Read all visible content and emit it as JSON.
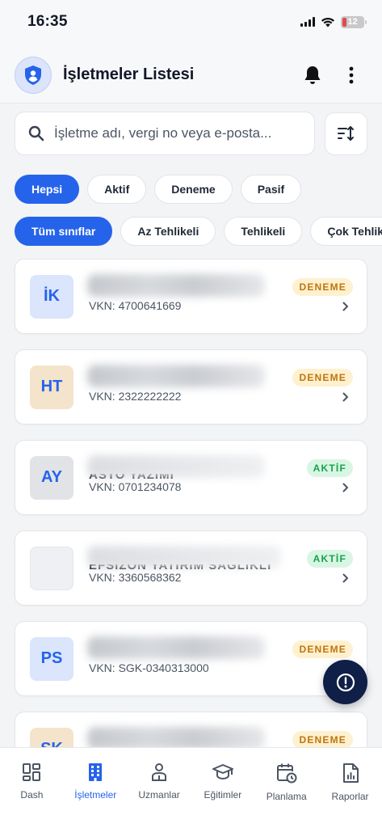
{
  "status_bar": {
    "time": "16:35",
    "battery": "12"
  },
  "header": {
    "title": "İşletmeler Listesi"
  },
  "search": {
    "placeholder": "İşletme adı, vergi no veya e-posta..."
  },
  "status_filters": [
    {
      "label": "Hepsi",
      "active": true
    },
    {
      "label": "Aktif",
      "active": false
    },
    {
      "label": "Deneme",
      "active": false
    },
    {
      "label": "Pasif",
      "active": false
    }
  ],
  "class_filters": [
    {
      "label": "Tüm sınıflar",
      "active": true
    },
    {
      "label": "Az Tehlikeli",
      "active": false
    },
    {
      "label": "Tehlikeli",
      "active": false
    },
    {
      "label": "Çok Tehlikeli",
      "active": false
    }
  ],
  "companies": [
    {
      "initials": "İK",
      "avatar_bg": "#dbe5fb",
      "vkn": "VKN: 4700641669",
      "status": "DENEME",
      "status_type": "deneme"
    },
    {
      "initials": "HT",
      "avatar_bg": "#f3e4cb",
      "vkn": "VKN: 2322222222",
      "status": "DENEME",
      "status_type": "deneme"
    },
    {
      "initials": "AY",
      "avatar_bg": "#e1e3e6",
      "vkn": "VKN: 0701234078",
      "status": "AKTİF",
      "status_type": "aktif",
      "name_partial": "ASTO YAZIMI"
    },
    {
      "initials": "",
      "avatar_bg": "#eef0f3",
      "vkn": "VKN: 3360568362",
      "status": "AKTİF",
      "status_type": "aktif",
      "name_partial": "EFSIZON YATIRIM SAGLIKLI"
    },
    {
      "initials": "PS",
      "avatar_bg": "#dbe5fb",
      "vkn": "VKN: SGK-0340313000",
      "status": "DENEME",
      "status_type": "deneme"
    },
    {
      "initials": "SK",
      "avatar_bg": "#f3e4cb",
      "vkn": "",
      "status": "DENEME",
      "status_type": "deneme"
    }
  ],
  "bottom_nav": [
    {
      "label": "Dash",
      "icon": "dashboard-icon",
      "active": false
    },
    {
      "label": "İşletmeler",
      "icon": "building-icon",
      "active": true
    },
    {
      "label": "Uzmanlar",
      "icon": "experts-icon",
      "active": false
    },
    {
      "label": "Eğitimler",
      "icon": "graduation-cap-icon",
      "active": false
    },
    {
      "label": "Planlama",
      "icon": "calendar-clock-icon",
      "active": false
    },
    {
      "label": "Raporlar",
      "icon": "report-icon",
      "active": false
    }
  ],
  "colors": {
    "accent": "#2563eb",
    "fab": "#0f1f47",
    "deneme": "#c2740c",
    "aktif": "#16a34a"
  }
}
